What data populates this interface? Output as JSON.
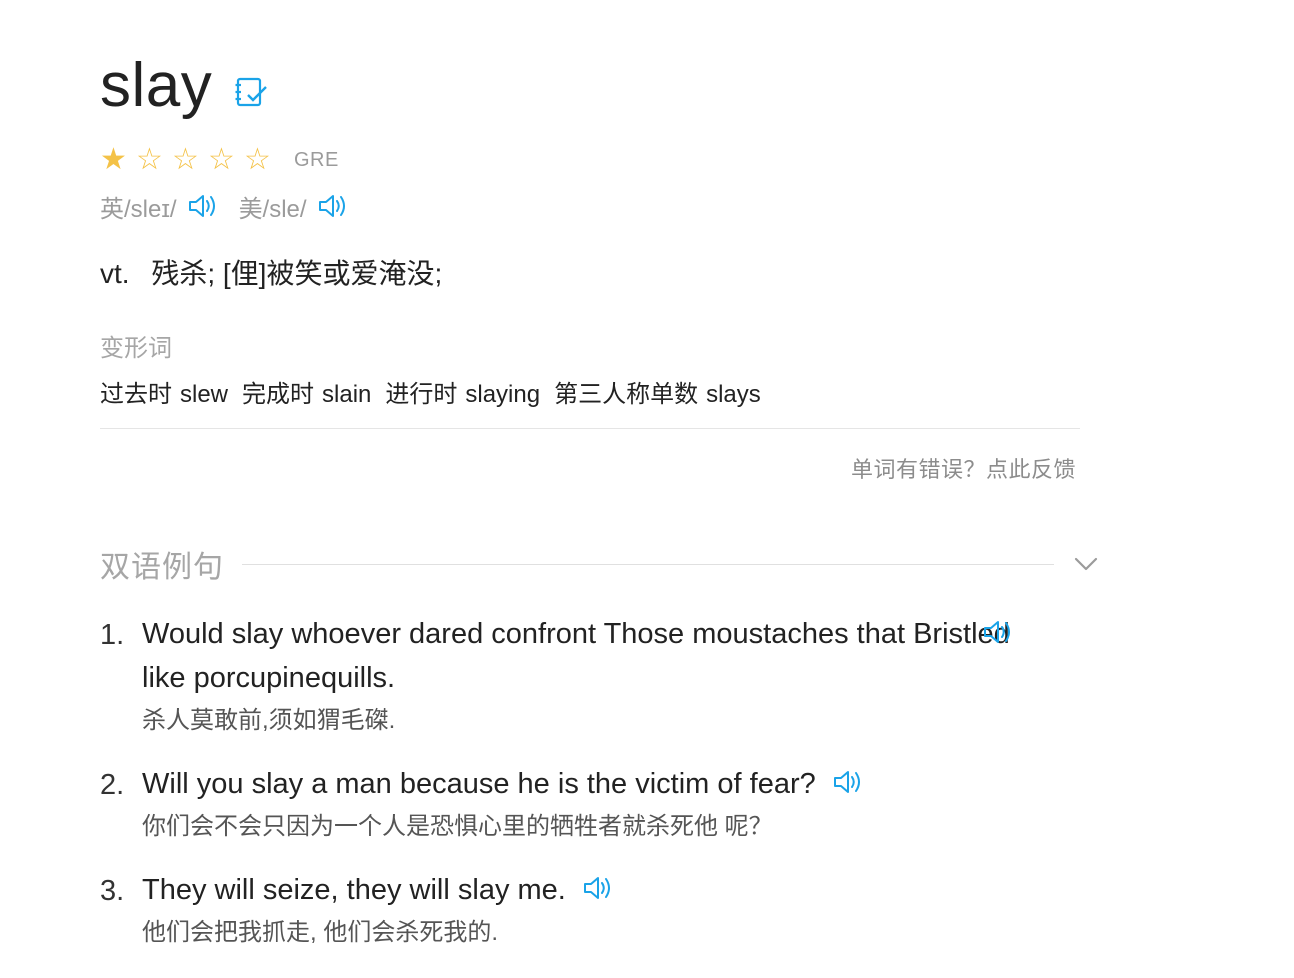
{
  "word": "slay",
  "icons": {
    "wordbook": "wordbook-add-icon",
    "speaker": "speaker-icon",
    "chevron": "chevron-down-icon",
    "star_filled": "star-filled-icon",
    "star_empty": "star-empty-icon"
  },
  "colors": {
    "accent": "#1aa3e8",
    "star": "#f4c247",
    "muted": "#9b9b9b"
  },
  "rating": {
    "filled": 1,
    "total": 5,
    "tag": "GRE"
  },
  "pronunciations": [
    {
      "label": "英/sleɪ/"
    },
    {
      "label": "美/sle/"
    }
  ],
  "definition": {
    "pos": "vt.",
    "meaning": "残杀; [俚]被笑或爱淹没;"
  },
  "inflections": {
    "label": "变形词",
    "items": [
      {
        "type": "过去时",
        "form": "slew"
      },
      {
        "type": "完成时",
        "form": "slain"
      },
      {
        "type": "进行时",
        "form": "slaying"
      },
      {
        "type": "第三人称单数",
        "form": "slays"
      }
    ]
  },
  "feedback": "单词有错误？点此反馈",
  "bilingual": {
    "title": "双语例句",
    "examples": [
      {
        "num": "1.",
        "en": "Would slay whoever dared confront Those moustaches that Bristled like porcupinequills.",
        "zh": "杀人莫敢前,须如猬毛磔."
      },
      {
        "num": "2.",
        "en": "Will you slay a man because he is the victim of fear?",
        "zh": "你们会不会只因为一个人是恐惧心里的牺牲者就杀死他 呢？"
      },
      {
        "num": "3.",
        "en": "They will seize, they will slay me.",
        "zh": "他们会把我抓走, 他们会杀死我的."
      }
    ]
  }
}
